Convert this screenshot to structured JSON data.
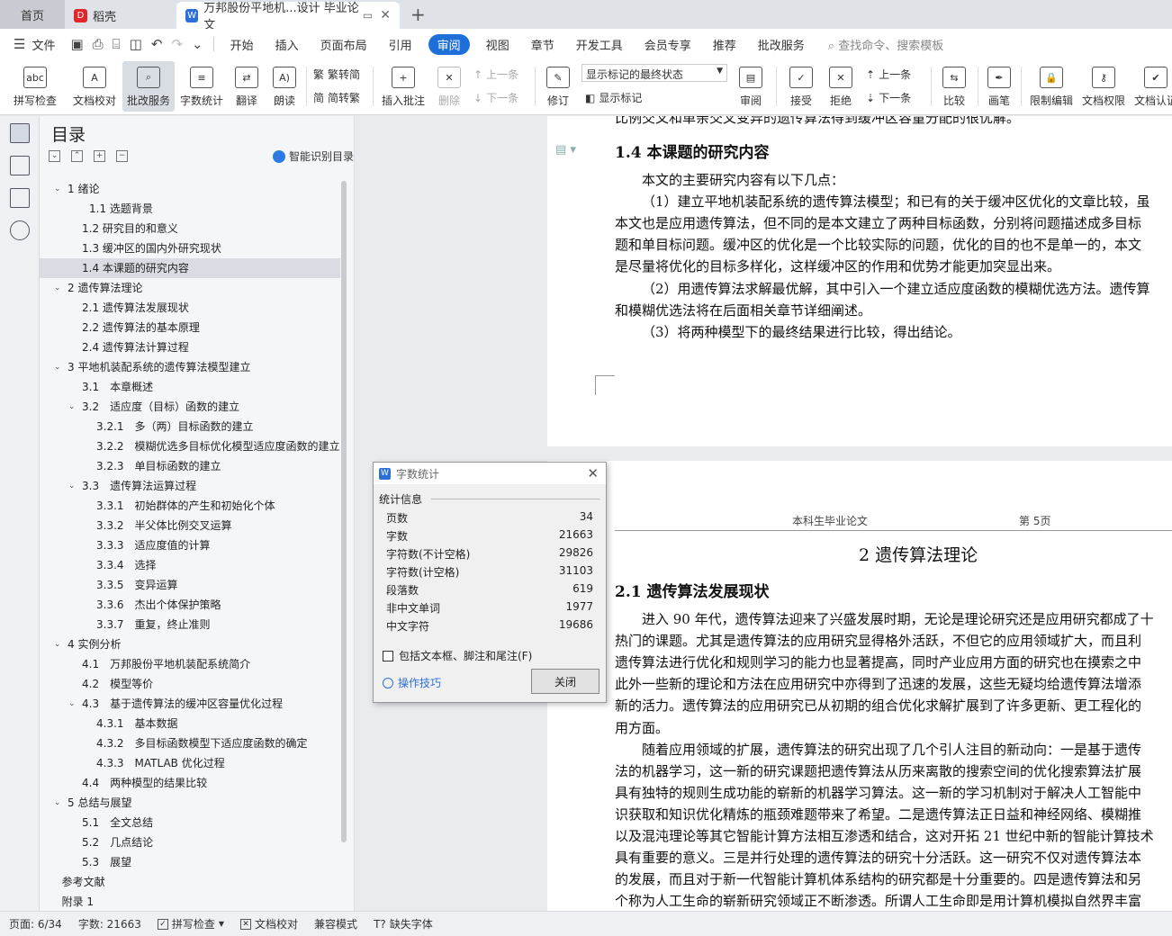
{
  "tabs": {
    "home": "首页",
    "daoke": "稻壳",
    "doc": "万邦股份平地机...设计 毕业论文"
  },
  "menu": {
    "file": "文件",
    "items": [
      "开始",
      "插入",
      "页面布局",
      "引用",
      "审阅",
      "视图",
      "章节",
      "开发工具",
      "会员专享",
      "推荐",
      "批改服务"
    ],
    "active": "审阅",
    "search": "查找命令、搜索模板"
  },
  "toolbar": {
    "spellcheck": "拼写检查",
    "proofread": "文档校对",
    "correction": "批改服务",
    "wordcount": "字数统计",
    "translate": "翻译",
    "read": "朗读",
    "trad": "繁转简",
    "simp": "简转繁",
    "insert_comment": "插入批注",
    "delete": "删除",
    "prev1": "上一条",
    "next1": "下一条",
    "revise": "修订",
    "markup_state": "显示标记的最终状态",
    "show_markup": "显示标记",
    "review": "审阅",
    "accept": "接受",
    "reject": "拒绝",
    "prev2": "上一条",
    "next2": "下一条",
    "compare": "比较",
    "pen": "画笔",
    "restrict": "限制编辑",
    "perm": "文档权限",
    "cert": "文档认证"
  },
  "toc": {
    "title": "目录",
    "smart": "智能识别目录",
    "items": [
      {
        "t": "1 绪论",
        "l": 0,
        "a": "v"
      },
      {
        "t": "1.1 选题背景",
        "l": 1.5
      },
      {
        "t": "1.2 研究目的和意义",
        "l": 1
      },
      {
        "t": "1.3 缓冲区的国内外研究现状",
        "l": 1
      },
      {
        "t": "1.4 本课题的研究内容",
        "l": 1,
        "sel": true
      },
      {
        "t": "2 遗传算法理论",
        "l": 0,
        "a": "v"
      },
      {
        "t": "2.1 遗传算法发展现状",
        "l": 1
      },
      {
        "t": "2.2 遗传算法的基本原理",
        "l": 1
      },
      {
        "t": "2.4 遗传算法计算过程",
        "l": 1
      },
      {
        "t": "3 平地机装配系统的遗传算法模型建立",
        "l": 0,
        "a": "v"
      },
      {
        "t": "3.1　本章概述",
        "l": 1
      },
      {
        "t": "3.2　适应度（目标）函数的建立",
        "l": 1,
        "a": "v"
      },
      {
        "t": "3.2.1　多（两）目标函数的建立",
        "l": 2
      },
      {
        "t": "3.2.2　模糊优选多目标优化模型适应度函数的建立",
        "l": 2
      },
      {
        "t": "3.2.3　单目标函数的建立",
        "l": 2
      },
      {
        "t": "3.3　遗传算法运算过程",
        "l": 1,
        "a": "v"
      },
      {
        "t": "3.3.1　初始群体的产生和初始化个体",
        "l": 2
      },
      {
        "t": "3.3.2　半父体比例交叉运算",
        "l": 2
      },
      {
        "t": "3.3.3　适应度值的计算",
        "l": 2
      },
      {
        "t": "3.3.4　选择",
        "l": 2
      },
      {
        "t": "3.3.5　变异运算",
        "l": 2
      },
      {
        "t": "3.3.6　杰出个体保护策略",
        "l": 2
      },
      {
        "t": "3.3.7　重复，终止准则",
        "l": 2
      },
      {
        "t": "4 实例分析",
        "l": 0,
        "a": "v"
      },
      {
        "t": "4.1　万邦股份平地机装配系统简介",
        "l": 1
      },
      {
        "t": "4.2　模型等价",
        "l": 1
      },
      {
        "t": "4.3　基于遗传算法的缓冲区容量优化过程",
        "l": 1,
        "a": "v"
      },
      {
        "t": "4.3.1　基本数据",
        "l": 2
      },
      {
        "t": "4.3.2　多目标函数模型下适应度函数的确定",
        "l": 2
      },
      {
        "t": "4.3.3　MATLAB 优化过程",
        "l": 2
      },
      {
        "t": "4.4　两种模型的结果比较",
        "l": 1
      },
      {
        "t": "5 总结与展望",
        "l": 0,
        "a": "v"
      },
      {
        "t": "5.1　全文总结",
        "l": 1
      },
      {
        "t": "5.2　几点结论",
        "l": 1
      },
      {
        "t": "5.3　展望",
        "l": 1
      },
      {
        "t": "参考文献",
        "l": -0.4
      },
      {
        "t": "附录 1",
        "l": -0.4
      }
    ]
  },
  "doc": {
    "p1_top": "比例交叉和单亲交叉变异的遗传算法得到缓冲区容量分配的很优解。",
    "h14": "1.4  本课题的研究内容",
    "p1_lines": [
      "本文的主要研究内容有以下几点：",
      "（1）建立平地机装配系统的遗传算法模型；和已有的关于缓冲区优化的文章比较，虽",
      "本文也是应用遗传算法，但不同的是本文建立了两种目标函数，分别将问题描述成多目标",
      "题和单目标问题。缓冲区的优化是一个比较实际的问题，优化的目的也不是单一的，本文",
      "是尽量将优化的目标多样化，这样缓冲区的作用和优势才能更加突显出来。",
      "（2）用遗传算法求解最优解，其中引入一个建立适应度函数的模糊优选方法。遗传算",
      "和模糊优选法将在后面相关章节详细阐述。",
      "（3）将两种模型下的最终结果进行比较，得出结论。"
    ],
    "header_left": "本科生毕业论文",
    "header_right": "第 5页",
    "h2": "2  遗传算法理论",
    "h21": "2.1  遗传算法发展现状",
    "p2_lines": [
      "进入 90 年代，遗传算法迎来了兴盛发展时期，无论是理论研究还是应用研究都成了十",
      "热门的课题。尤其是遗传算法的应用研究显得格外活跃，不但它的应用领域扩大，而且利",
      "遗传算法进行优化和规则学习的能力也显著提高，同时产业应用方面的研究也在摸索之中",
      "此外一些新的理论和方法在应用研究中亦得到了迅速的发展，这些无疑均给遗传算法增添",
      "新的活力。遗传算法的应用研究已从初期的组合优化求解扩展到了许多更新、更工程化的",
      "用方面。",
      "随着应用领域的扩展，遗传算法的研究出现了几个引人注目的新动向：一是基于遗传",
      "法的机器学习，这一新的研究课题把遗传算法从历来离散的搜索空间的优化搜索算法扩展",
      "具有独特的规则生成功能的崭新的机器学习算法。这一新的学习机制对于解决人工智能中",
      "识获取和知识优化精炼的瓶颈难题带来了希望。二是遗传算法正日益和神经网络、模糊推",
      "以及混沌理论等其它智能计算方法相互渗透和结合，这对开拓 21 世纪中新的智能计算技术",
      "具有重要的意义。三是并行处理的遗传算法的研究十分活跃。这一研究不仅对遗传算法本",
      "的发展，而且对于新一代智能计算机体系结构的研究都是十分重要的。四是遗传算法和另",
      "个称为人工生命的崭新研究领域正不断渗透。所谓人工生命即是用计算机模拟自然界丰富"
    ]
  },
  "dialog": {
    "title": "字数统计",
    "section": "统计信息",
    "stats": [
      {
        "k": "页数",
        "v": "34"
      },
      {
        "k": "字数",
        "v": "21663"
      },
      {
        "k": "字符数(不计空格)",
        "v": "29826"
      },
      {
        "k": "字符数(计空格)",
        "v": "31103"
      },
      {
        "k": "段落数",
        "v": "619"
      },
      {
        "k": "非中文单词",
        "v": "1977"
      },
      {
        "k": "中文字符",
        "v": "19686"
      }
    ],
    "include": "包括文本框、脚注和尾注(F)",
    "tips": "操作技巧",
    "close": "关闭"
  },
  "status": {
    "page": "页面: 6/34",
    "words": "字数: 21663",
    "spell": "拼写检查",
    "proof": "文档校对",
    "compat": "兼容模式",
    "font": "缺失字体"
  }
}
